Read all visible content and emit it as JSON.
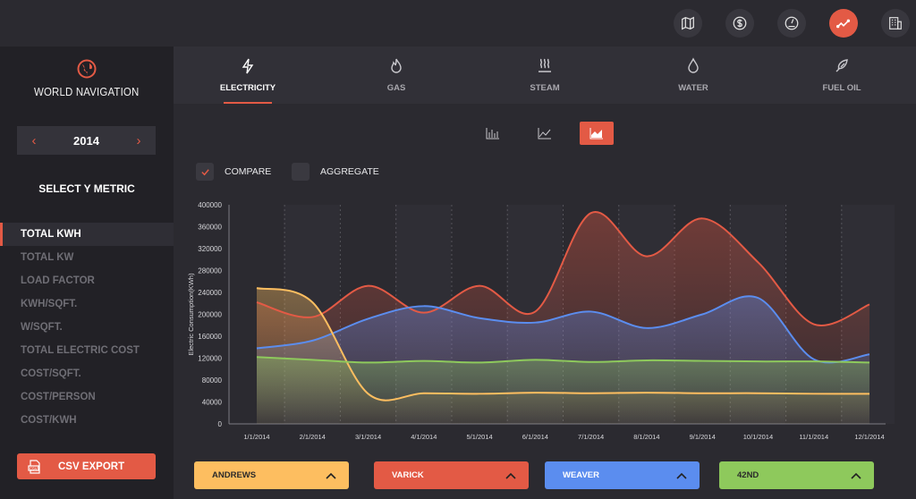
{
  "topnav": {
    "icons": [
      "map-icon",
      "dollar-icon",
      "gauge-icon",
      "trend-icon",
      "building-icon"
    ],
    "active": "trend-icon"
  },
  "sidebar": {
    "logo_text": "WORLD NAVIGATION",
    "year": "2014",
    "y_metric_title": "SELECT Y METRIC",
    "metrics": [
      "TOTAL KWH",
      "TOTAL KW",
      "LOAD FACTOR",
      "KWH/SQFT.",
      "W/SQFT.",
      "TOTAL ELECTRIC COST",
      "COST/SQFT.",
      "COST/PERSON",
      "COST/KWH"
    ],
    "active_metric": "TOTAL KWH",
    "csv_label": "CSV EXPORT"
  },
  "tabs": [
    {
      "label": "ELECTRICITY",
      "icon": "bolt-icon",
      "active": true
    },
    {
      "label": "GAS",
      "icon": "flame-icon",
      "active": false
    },
    {
      "label": "STEAM",
      "icon": "steam-icon",
      "active": false
    },
    {
      "label": "WATER",
      "icon": "drop-icon",
      "active": false
    },
    {
      "label": "FUEL OIL",
      "icon": "fuel-icon",
      "active": false
    }
  ],
  "chart_types": [
    "bar-chart-icon",
    "line-chart-icon",
    "area-chart-icon"
  ],
  "active_chart_type": "area-chart-icon",
  "options": {
    "compare_label": "COMPARE",
    "compare_checked": true,
    "aggregate_label": "AGGREGATE",
    "aggregate_checked": false
  },
  "legend": [
    {
      "name": "ANDREWS",
      "color": "#fdbe60"
    },
    {
      "name": "VARICK",
      "color": "#e35a45"
    },
    {
      "name": "WEAVER",
      "color": "#5b8def"
    },
    {
      "name": "42ND",
      "color": "#8ec95c"
    }
  ],
  "chart_data": {
    "type": "area",
    "ylabel": "Electric Consumption(KWh)",
    "ylim": [
      0,
      400000
    ],
    "yticks": [
      0,
      40000,
      80000,
      120000,
      160000,
      200000,
      240000,
      280000,
      320000,
      360000,
      400000
    ],
    "categories": [
      "1/1/2014",
      "2/1/2014",
      "3/1/2014",
      "4/1/2014",
      "5/1/2014",
      "6/1/2014",
      "7/1/2014",
      "8/1/2014",
      "9/1/2014",
      "10/1/2014",
      "11/1/2014",
      "12/1/2014"
    ],
    "grid": true,
    "series": [
      {
        "name": "ANDREWS",
        "color": "#fdbe60",
        "values": [
          248000,
          222000,
          55000,
          56000,
          55000,
          57000,
          56000,
          57000,
          56000,
          56000,
          55000,
          55000
        ]
      },
      {
        "name": "VARICK",
        "color": "#e35a45",
        "values": [
          222000,
          195000,
          252000,
          203000,
          252000,
          205000,
          385000,
          306000,
          375000,
          295000,
          182000,
          218000
        ]
      },
      {
        "name": "WEAVER",
        "color": "#5b8def",
        "values": [
          138000,
          152000,
          192000,
          215000,
          193000,
          185000,
          205000,
          175000,
          200000,
          230000,
          118000,
          127000
        ]
      },
      {
        "name": "42ND",
        "color": "#8ec95c",
        "values": [
          122000,
          117000,
          112000,
          115000,
          112000,
          117000,
          113000,
          116000,
          115000,
          114000,
          114000,
          112000
        ]
      }
    ]
  }
}
